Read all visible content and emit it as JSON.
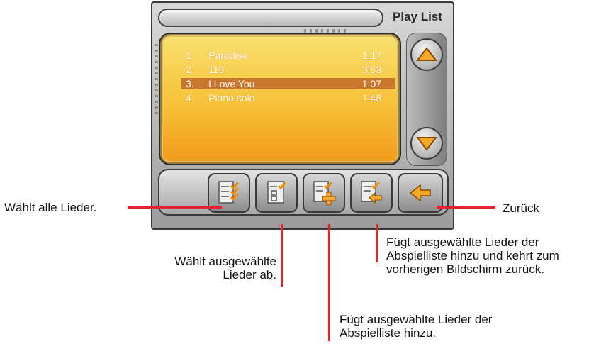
{
  "header": {
    "title": "Play List"
  },
  "playlist": {
    "items": [
      {
        "num": "1.",
        "title": "Paradise",
        "time": "1:17",
        "selected": false
      },
      {
        "num": "2.",
        "title": "119",
        "time": "3:53",
        "selected": false
      },
      {
        "num": "3.",
        "title": "I Love You",
        "time": "1:07",
        "selected": true
      },
      {
        "num": "4.",
        "title": "Piano solo",
        "time": "1:48",
        "selected": false
      }
    ]
  },
  "icons": {
    "scroll_up": "arrow-up-icon",
    "scroll_down": "arrow-down-icon",
    "select_all": "checklist-all-icon",
    "deselect": "checklist-deselect-icon",
    "add_to_playlist": "playlist-add-icon",
    "add_and_return": "playlist-add-return-icon",
    "back": "back-arrow-icon"
  },
  "annotations": {
    "select_all": "Wählt alle Lieder.",
    "back": "Zurück",
    "deselect_line1": "Wählt ausgewählte",
    "deselect_line2": "Lieder ab.",
    "add_return_line1": "Fügt ausgewählte Lieder der",
    "add_return_line2": "Abspielliste hinzu und kehrt zum",
    "add_return_line3": "vorherigen Bildschirm zurück.",
    "add_line1": "Fügt ausgewählte Lieder der",
    "add_line2": "Abspielliste hinzu."
  },
  "colors": {
    "accent_orange": "#f7a827",
    "selected_row": "#c9772c",
    "callout_line": "#e8212e"
  }
}
